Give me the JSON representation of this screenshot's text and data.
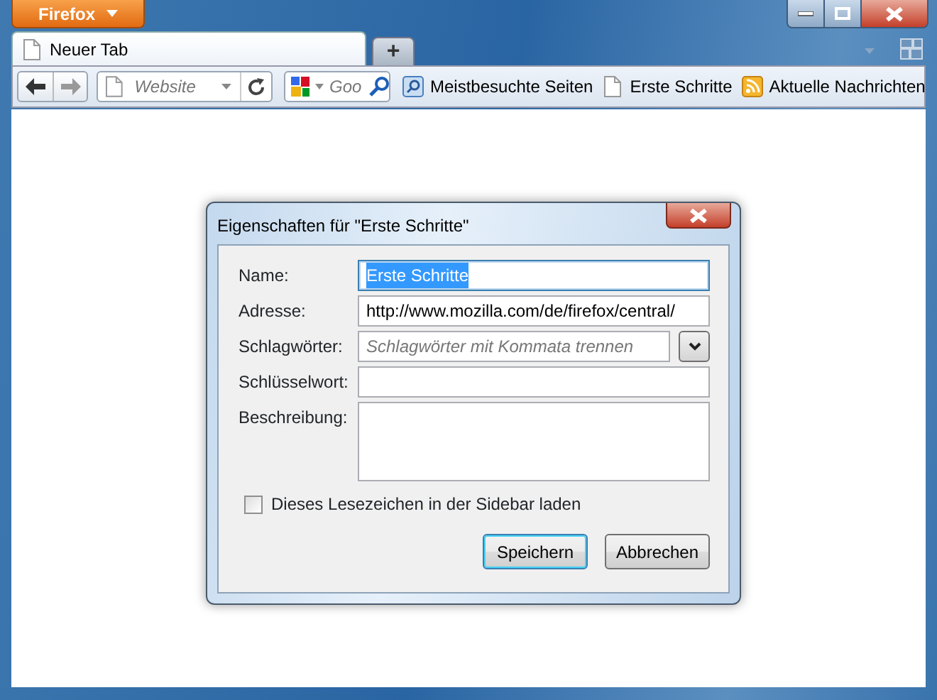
{
  "window": {
    "app_button": "Firefox"
  },
  "tabs": [
    {
      "label": "Neuer Tab",
      "selected": true
    }
  ],
  "new_tab_button": "+",
  "navigation": {
    "url_placeholder": "Website",
    "search_placeholder": "Goo"
  },
  "bookmarks": [
    {
      "label": "Meistbesuchte Seiten",
      "kind": "smart"
    },
    {
      "label": "Erste Schritte",
      "kind": "page"
    },
    {
      "label": "Aktuelle Nachrichten",
      "kind": "feed"
    }
  ],
  "dialog": {
    "title": "Eigenschaften für \"Erste Schritte\"",
    "fields": [
      {
        "label": "Name:",
        "kind": "text",
        "value": "Erste Schritte",
        "selected": true
      },
      {
        "label": "Adresse:",
        "kind": "text",
        "value": "http://www.mozilla.com/de/firefox/central/",
        "selected": false
      },
      {
        "label": "Schlagwörter:",
        "kind": "tags",
        "placeholder": "Schlagwörter mit Kommata trennen",
        "selected": false
      },
      {
        "label": "Schlüsselwort:",
        "kind": "text",
        "selected": false
      },
      {
        "label": "Beschreibung:",
        "kind": "textarea",
        "selected": false
      }
    ],
    "sidebar_checkbox": {
      "label": "Dieses Lesezeichen in der Sidebar laden",
      "checked": false
    },
    "buttons": [
      {
        "label": "Speichern",
        "default": true
      },
      {
        "label": "Abbrechen",
        "default": false
      }
    ]
  }
}
